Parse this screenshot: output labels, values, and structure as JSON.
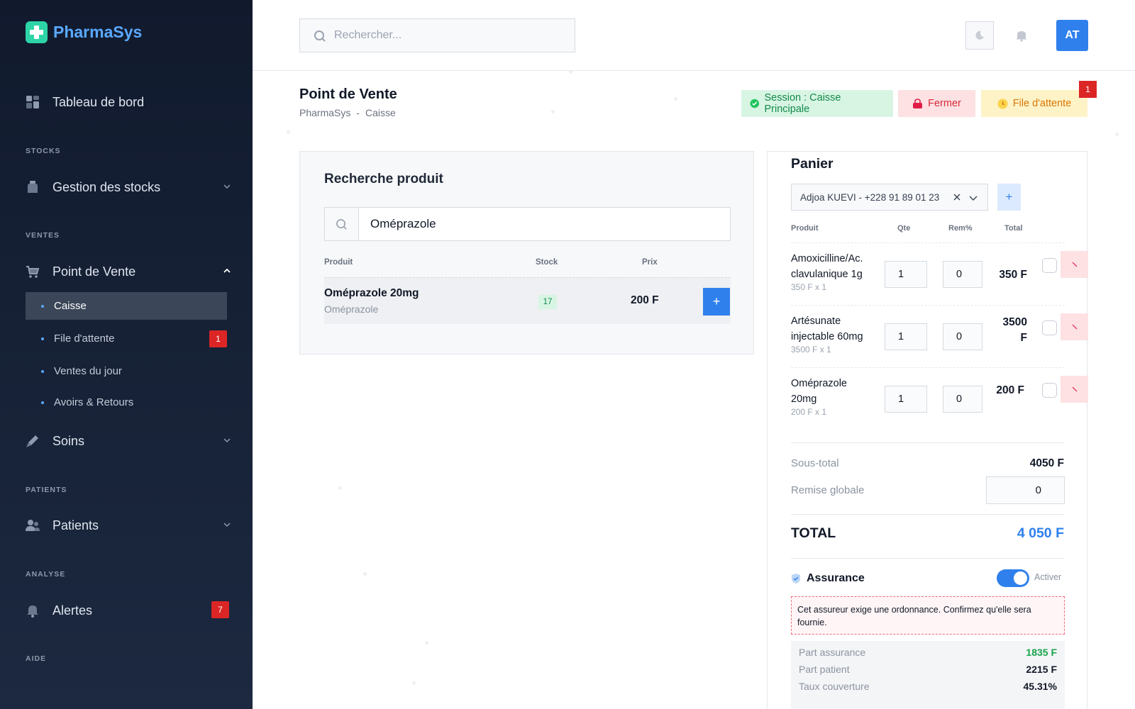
{
  "app": {
    "name": "PharmaSys"
  },
  "sidebar": {
    "dashboard": "Tableau de bord",
    "sections": {
      "stocks": "STOCKS",
      "ventes": "VENTES",
      "patients": "PATIENTS",
      "analyse": "ANALYSE",
      "aide": "AIDE"
    },
    "stocks_item": "Gestion des stocks",
    "pos_item": "Point de Vente",
    "pos_sub": [
      {
        "label": "Caisse",
        "active": true
      },
      {
        "label": "File d'attente",
        "badge": "1"
      },
      {
        "label": "Ventes du jour"
      },
      {
        "label": "Avoirs & Retours"
      }
    ],
    "soins_item": "Soins",
    "patients_item": "Patients",
    "alertes_item": "Alertes",
    "alertes_badge": "7"
  },
  "topbar": {
    "search_placeholder": "Rechercher...",
    "avatar_initials": "AT"
  },
  "page": {
    "title": "Point de Vente",
    "breadcrumb": [
      "PharmaSys",
      "-",
      "Caisse"
    ],
    "session_label": "Session : Caisse Principale",
    "close_label": "Fermer",
    "queue_label": "File d'attente",
    "queue_badge": "1"
  },
  "product_search": {
    "title": "Recherche produit",
    "query": "Oméprazole",
    "columns": [
      "Produit",
      "Stock",
      "Prix"
    ],
    "results": [
      {
        "name": "Oméprazole 20mg",
        "generic": "Oméprazole",
        "stock": "17",
        "price": "200 F",
        "add": "+"
      }
    ]
  },
  "cart": {
    "title": "Panier",
    "client": "Adjoa KUEVI - +228 91 89 01 23",
    "add_client": "+",
    "columns": [
      "Produit",
      "Qte",
      "Rem%",
      "Total"
    ],
    "items": [
      {
        "name": "Amoxicilline/Ac. clavulanique 1g",
        "detail": "350 F x 1",
        "qty": "1",
        "rem": "0",
        "total": "350 F"
      },
      {
        "name": "Artésunate injectable 60mg",
        "detail": "3500 F x 1",
        "qty": "1",
        "rem": "0",
        "total": "3500 F"
      },
      {
        "name": "Oméprazole 20mg",
        "detail": "200 F x 1",
        "qty": "1",
        "rem": "0",
        "total": "200 F"
      }
    ],
    "subtotal_label": "Sous-total",
    "subtotal": "4050 F",
    "discount_label": "Remise globale",
    "discount": "0",
    "total_label": "TOTAL",
    "total": "4 050 F",
    "insurance": {
      "label": "Assurance",
      "toggle_label": "Activer",
      "enabled": true,
      "warning": "Cet assureur exige une ordonnance. Confirmez qu'elle sera fournie.",
      "rows": [
        {
          "label": "Part assurance",
          "value": "1835 F"
        },
        {
          "label": "Part patient",
          "value": "2215 F"
        },
        {
          "label": "Taux couverture",
          "value": "45.31%"
        }
      ]
    }
  },
  "colors": {
    "primary": "#2f80ed",
    "sidebar": "#111a2d",
    "brand_icon": "#2dd4a7",
    "danger": "#dc2626",
    "success": "#16a34a"
  }
}
